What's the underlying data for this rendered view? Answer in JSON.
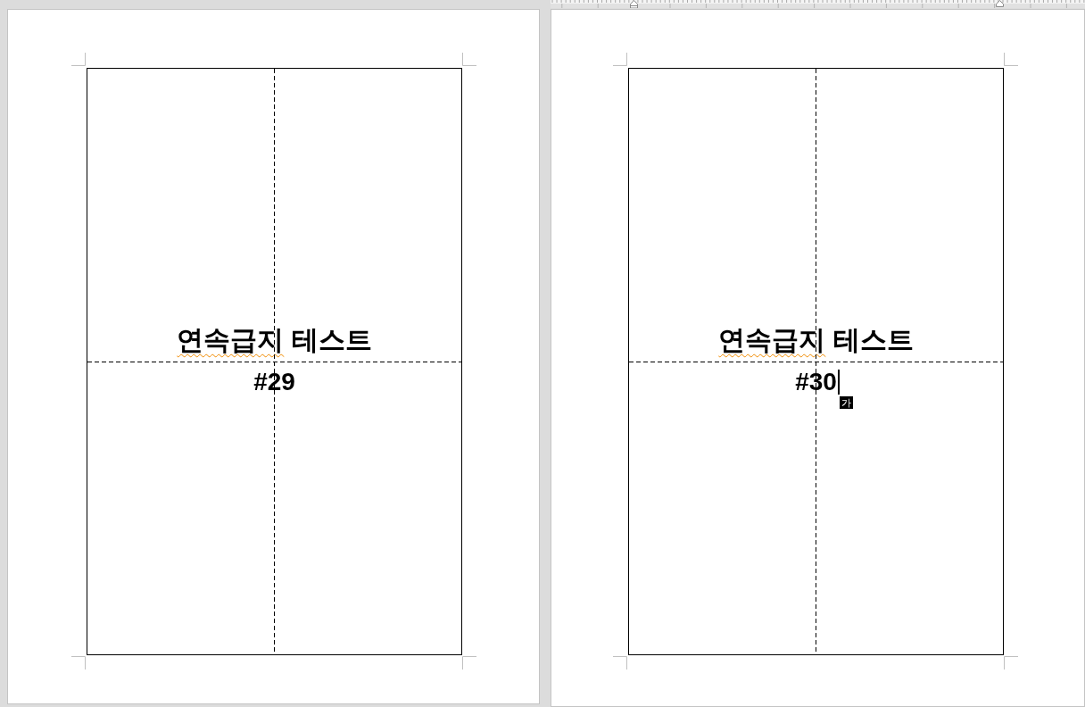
{
  "pages": [
    {
      "title_segments": [
        {
          "text": "연속급지",
          "spelling_flag": true
        },
        {
          "text": " 테스트",
          "spelling_flag": false
        }
      ],
      "number": "#29",
      "cursor": false
    },
    {
      "title_segments": [
        {
          "text": "연속급지",
          "spelling_flag": true
        },
        {
          "text": " 테스트",
          "spelling_flag": false
        }
      ],
      "number": "#30",
      "cursor": true,
      "ime_indicator": "가"
    }
  ]
}
